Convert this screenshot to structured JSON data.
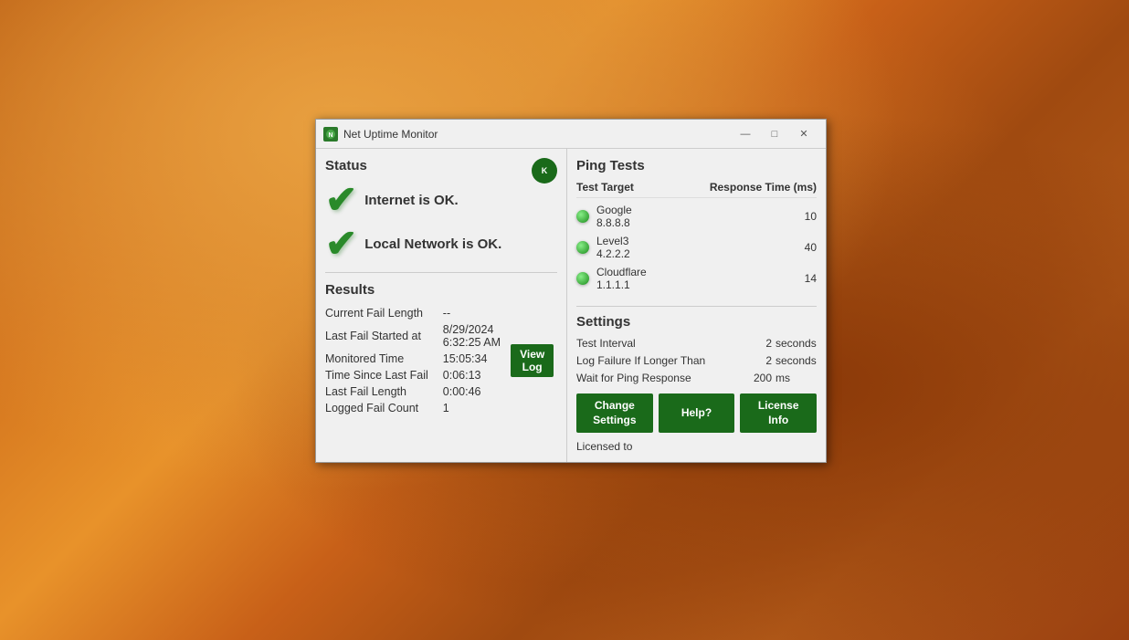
{
  "desktop": {
    "bg_color": "#c8702a"
  },
  "window": {
    "title": "Net Uptime Monitor",
    "titlebar": {
      "minimize_label": "—",
      "maximize_label": "□",
      "close_label": "✕"
    }
  },
  "status": {
    "section_title": "Status",
    "internet_status": "Internet is OK.",
    "local_status": "Local Network is OK.",
    "badge_icon": "K"
  },
  "results": {
    "section_title": "Results",
    "current_fail_length_label": "Current Fail Length",
    "current_fail_length_value": "--",
    "last_fail_started_label": "Last Fail Started at",
    "last_fail_started_value": "8/29/2024\n6:32:25 AM",
    "monitored_time_label": "Monitored Time",
    "monitored_time_value": "15:05:34",
    "time_since_last_fail_label": "Time Since Last Fail",
    "time_since_last_fail_value": "0:06:13",
    "last_fail_length_label": "Last Fail Length",
    "last_fail_length_value": "0:00:46",
    "logged_fail_count_label": "Logged Fail Count",
    "logged_fail_count_value": "1",
    "view_log_btn": "View\nLog"
  },
  "ping_tests": {
    "section_title": "Ping Tests",
    "col_target": "Test Target",
    "col_response": "Response Time (ms)",
    "rows": [
      {
        "name": "Google",
        "ip": "8.8.8.8",
        "response": "10"
      },
      {
        "name": "Level3",
        "ip": "4.2.2.2",
        "response": "40"
      },
      {
        "name": "Cloudflare",
        "ip": "1.1.1.1",
        "response": "14"
      }
    ]
  },
  "settings": {
    "section_title": "Settings",
    "test_interval_label": "Test Interval",
    "test_interval_value": "2",
    "test_interval_unit": "seconds",
    "log_failure_label": "Log Failure If Longer Than",
    "log_failure_value": "2",
    "log_failure_unit": "seconds",
    "wait_ping_label": "Wait for Ping Response",
    "wait_ping_value": "200",
    "wait_ping_unit": "ms",
    "change_settings_btn": "Change\nSettings",
    "help_btn": "Help?",
    "license_info_btn": "License\nInfo",
    "licensed_to_label": "Licensed to"
  }
}
